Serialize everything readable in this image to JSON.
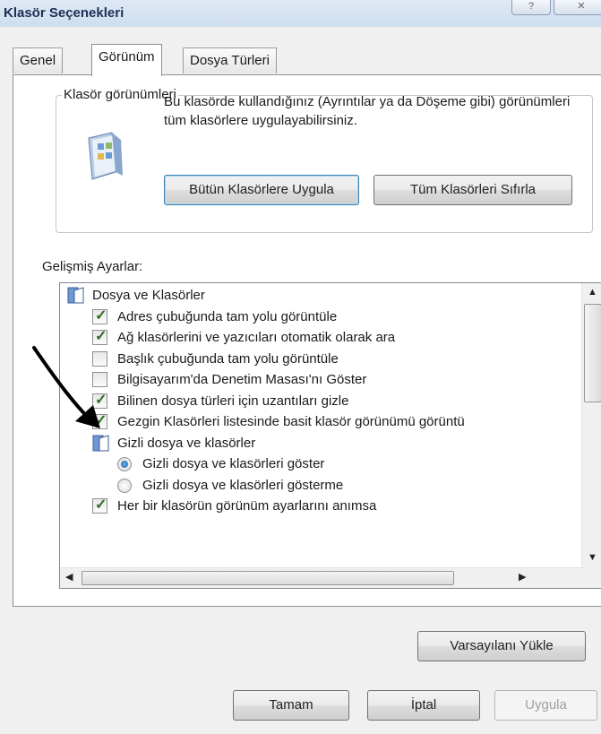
{
  "window": {
    "title": "Klasör Seçenekleri",
    "caption_buttons": [
      "?",
      "✕"
    ]
  },
  "tabs": [
    {
      "label": "Genel",
      "active": false
    },
    {
      "label": "Görünüm",
      "active": true
    },
    {
      "label": "Dosya Türleri",
      "active": false
    }
  ],
  "folder_views": {
    "group_title": "Klasör görünümleri",
    "description": "Bu klasörde kullandığınız (Ayrıntılar ya da Döşeme gibi) görünümleri tüm klasörlere uygulayabilirsiniz.",
    "apply_button": "Bütün Klasörlere Uygula",
    "reset_button": "Tüm Klasörleri Sıfırla"
  },
  "advanced": {
    "label": "Gelişmiş Ayarlar:",
    "items": [
      {
        "type": "folder",
        "label": "Dosya ve Klasörler",
        "indent": 0
      },
      {
        "type": "checkbox",
        "label": "Adres çubuğunda tam yolu görüntüle",
        "checked": true,
        "indent": 1
      },
      {
        "type": "checkbox",
        "label": "Ağ klasörlerini ve yazıcıları otomatik olarak ara",
        "checked": true,
        "indent": 1
      },
      {
        "type": "checkbox",
        "label": "Başlık çubuğunda tam yolu görüntüle",
        "checked": false,
        "indent": 1
      },
      {
        "type": "checkbox",
        "label": "Bilgisayarım'da Denetim Masası'nı Göster",
        "checked": false,
        "indent": 1
      },
      {
        "type": "checkbox",
        "label": "Bilinen dosya türleri için uzantıları gizle",
        "checked": true,
        "indent": 1
      },
      {
        "type": "checkbox",
        "label": "Gezgin Klasörleri listesinde basit klasör görünümü görüntü",
        "checked": true,
        "indent": 1
      },
      {
        "type": "folder",
        "label": "Gizli dosya ve klasörler",
        "indent": 1
      },
      {
        "type": "radio",
        "label": "Gizli dosya ve klasörleri göster",
        "selected": true,
        "indent": 2
      },
      {
        "type": "radio",
        "label": "Gizli dosya ve klasörleri gösterme",
        "selected": false,
        "indent": 2
      },
      {
        "type": "checkbox",
        "label": "Her bir klasörün görünüm ayarlarını anımsa",
        "checked": true,
        "indent": 1
      }
    ]
  },
  "restore_defaults_button": "Varsayılanı Yükle",
  "footer": {
    "ok": "Tamam",
    "cancel": "İptal",
    "apply": "Uygula"
  },
  "colors": {
    "check_mark": "#2d6b23",
    "radio_dot": "#1c5ea6",
    "title_text": "#1e2f55"
  }
}
